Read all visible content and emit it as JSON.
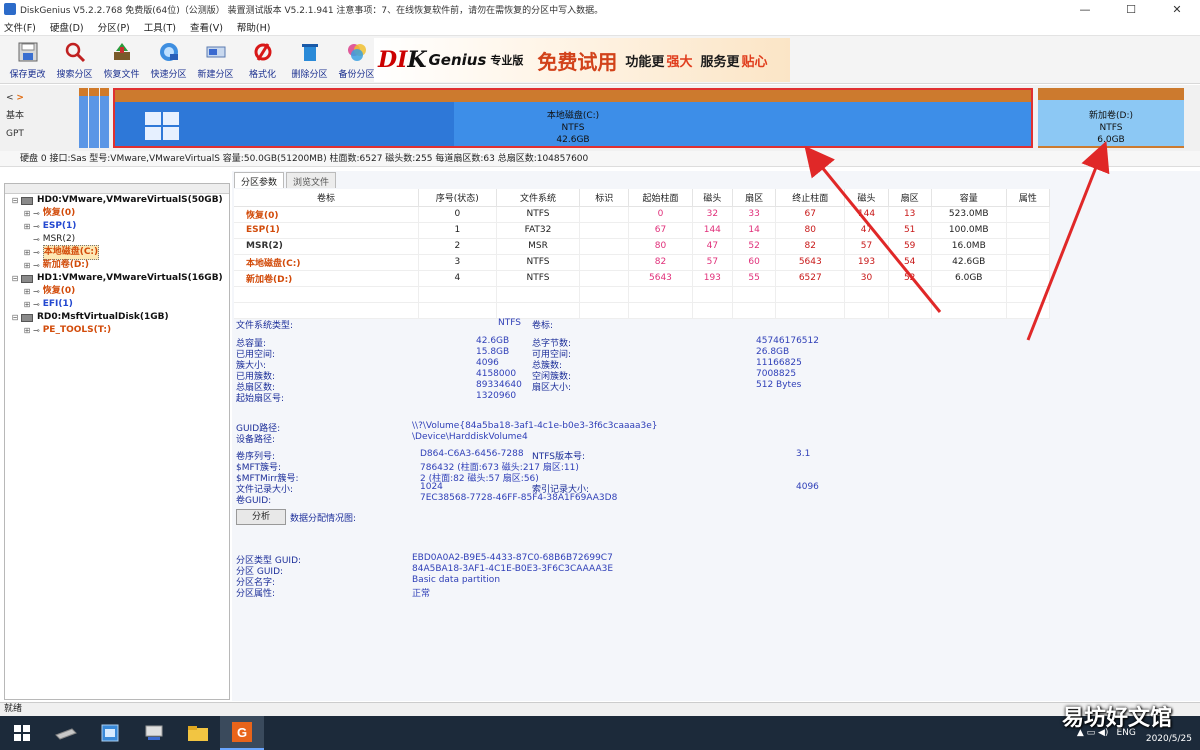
{
  "window": {
    "title": "DiskGenius V5.2.2.768 免费版(64位)（公测版） 装置测试版本 V5.2.1.941 注意事项：7、在线恢复软件前，请勿在需恢复的分区中写入数据。",
    "controls": [
      "—",
      "☐",
      "✕"
    ]
  },
  "menu": [
    "文件(F)",
    "硬盘(D)",
    "分区(P)",
    "工具(T)",
    "查看(V)",
    "帮助(H)"
  ],
  "toolbar": [
    {
      "label": "保存更改",
      "icon": "save-icon"
    },
    {
      "label": "搜索分区",
      "icon": "search-icon"
    },
    {
      "label": "恢复文件",
      "icon": "recover-icon"
    },
    {
      "label": "快速分区",
      "icon": "quick-partition-icon"
    },
    {
      "label": "新建分区",
      "icon": "new-partition-icon"
    },
    {
      "label": "格式化",
      "icon": "format-icon"
    },
    {
      "label": "删除分区",
      "icon": "delete-icon"
    },
    {
      "label": "备份分区",
      "icon": "backup-icon"
    }
  ],
  "banner": {
    "logo_left": "DI",
    "logo_mid": "K",
    "logo_right": "Genius",
    "edition": "专业版",
    "slogan1": "免费试用",
    "slogan2": "功能更",
    "slogan3": "强大",
    "slogan4": "服务更",
    "slogan5": "贴心"
  },
  "disk_nav": {
    "back": "<",
    "forward": ">",
    "basic": "基本",
    "gpt": "GPT"
  },
  "disk_map": {
    "main": {
      "name": "本地磁盘(C:)",
      "fs": "NTFS",
      "size": "42.6GB"
    },
    "right": {
      "name": "新加卷(D:)",
      "fs": "NTFS",
      "size": "6.0GB"
    },
    "main_used_fraction": 0.37
  },
  "disk_info": "硬盘 0  接口:Sas  型号:VMware,VMwareVirtualS  容量:50.0GB(51200MB)  柱面数:6527  磁头数:255  每道扇区数:63  总扇区数:104857600",
  "tree": [
    {
      "indent": 0,
      "toggle": "⊟",
      "type": "disk",
      "label": "HD0:VMware,VMwareVirtualS(50GB)",
      "cls": "bold"
    },
    {
      "indent": 1,
      "toggle": "⊞",
      "type": "part",
      "label": "恢复(0)",
      "cls": "orange"
    },
    {
      "indent": 1,
      "toggle": "⊞",
      "type": "part",
      "label": "ESP(1)",
      "cls": "blue"
    },
    {
      "indent": 1,
      "toggle": "",
      "type": "part",
      "label": "MSR(2)",
      "cls": ""
    },
    {
      "indent": 1,
      "toggle": "⊞",
      "type": "part",
      "label": "本地磁盘(C:)",
      "cls": "orange sel"
    },
    {
      "indent": 1,
      "toggle": "⊞",
      "type": "part",
      "label": "新加卷(D:)",
      "cls": "orange"
    },
    {
      "indent": 0,
      "toggle": "⊟",
      "type": "disk",
      "label": "HD1:VMware,VMwareVirtualS(16GB)",
      "cls": "bold"
    },
    {
      "indent": 1,
      "toggle": "⊞",
      "type": "part",
      "label": "恢复(0)",
      "cls": "orange"
    },
    {
      "indent": 1,
      "toggle": "⊞",
      "type": "part",
      "label": "EFI(1)",
      "cls": "blue"
    },
    {
      "indent": 0,
      "toggle": "⊟",
      "type": "disk",
      "label": "RD0:MsftVirtualDisk(1GB)",
      "cls": "bold"
    },
    {
      "indent": 1,
      "toggle": "⊞",
      "type": "part",
      "label": "PE_TOOLS(T:)",
      "cls": "orange"
    }
  ],
  "tabs": [
    "分区参数",
    "浏览文件"
  ],
  "table": {
    "headers": [
      "卷标",
      "序号(状态)",
      "文件系统",
      "标识",
      "起始柱面",
      "磁头",
      "扇区",
      "终止柱面",
      "磁头",
      "扇区",
      "容量",
      "属性"
    ],
    "rows": [
      [
        "恢复(0)",
        "0",
        "NTFS",
        "",
        "0",
        "32",
        "33",
        "67",
        "144",
        "13",
        "523.0MB",
        ""
      ],
      [
        "ESP(1)",
        "1",
        "FAT32",
        "",
        "67",
        "144",
        "14",
        "80",
        "47",
        "51",
        "100.0MB",
        ""
      ],
      [
        "MSR(2)",
        "2",
        "MSR",
        "",
        "80",
        "47",
        "52",
        "82",
        "57",
        "59",
        "16.0MB",
        ""
      ],
      [
        "本地磁盘(C:)",
        "3",
        "NTFS",
        "",
        "82",
        "57",
        "60",
        "5643",
        "193",
        "54",
        "42.6GB",
        ""
      ],
      [
        "新加卷(D:)",
        "4",
        "NTFS",
        "",
        "5643",
        "193",
        "55",
        "6527",
        "30",
        "52",
        "6.0GB",
        ""
      ]
    ]
  },
  "props": {
    "fs_type_label": "文件系统类型:",
    "fs_type_value": "NTFS",
    "volume_label": "卷标:",
    "left": [
      {
        "k": "总容量:",
        "v": "42.6GB"
      },
      {
        "k": "已用空间:",
        "v": "15.8GB"
      },
      {
        "k": "簇大小:",
        "v": "4096"
      },
      {
        "k": "已用簇数:",
        "v": "4158000"
      },
      {
        "k": "总扇区数:",
        "v": "89334640"
      },
      {
        "k": "起始扇区号:",
        "v": "1320960"
      }
    ],
    "right": [
      {
        "k": "总字节数:",
        "v": "45746176512"
      },
      {
        "k": "可用空间:",
        "v": "26.8GB"
      },
      {
        "k": "总簇数:",
        "v": "11166825"
      },
      {
        "k": "空闲簇数:",
        "v": "7008825"
      },
      {
        "k": "扇区大小:",
        "v": "512 Bytes"
      }
    ],
    "guid_path_label": "GUID路径:",
    "guid_path": "\\\\?\\Volume{84a5ba18-3af1-4c1e-b0e3-3f6c3caaaa3e}",
    "dev_path_label": "设备路径:",
    "dev_path": "\\Device\\HarddiskVolume4",
    "ntfs": [
      {
        "k": "卷序列号:",
        "v": "D864-C6A3-6456-7288",
        "k2": "NTFS版本号:",
        "v2": "3.1"
      },
      {
        "k": "$MFT簇号:",
        "v": "786432 (柱面:673 磁头:217 扇区:11)",
        "k2": "",
        "v2": ""
      },
      {
        "k": "$MFTMirr簇号:",
        "v": "2 (柱面:82 磁头:57 扇区:56)",
        "k2": "",
        "v2": ""
      },
      {
        "k": "文件记录大小:",
        "v": "1024",
        "k2": "索引记录大小:",
        "v2": "4096"
      },
      {
        "k": "卷GUID:",
        "v": "7EC38568-7728-46FF-85F4-38A1F69AA3D8",
        "k2": "",
        "v2": ""
      }
    ],
    "analyze_button": "分析",
    "analyze_text": "数据分配情况图:",
    "bottom": [
      {
        "k": "分区类型 GUID:",
        "v": "EBD0A0A2-B9E5-4433-87C0-68B6B72699C7"
      },
      {
        "k": "分区 GUID:",
        "v": "84A5BA18-3AF1-4C1E-B0E3-3F6C3CAAAA3E"
      },
      {
        "k": "分区名字:",
        "v": "Basic data partition"
      },
      {
        "k": "分区属性:",
        "v": "正常"
      }
    ]
  },
  "status": "就绪",
  "taskbar": {
    "time": "ENG",
    "date": "2020/5/25"
  },
  "watermark": "易坊好文馆"
}
